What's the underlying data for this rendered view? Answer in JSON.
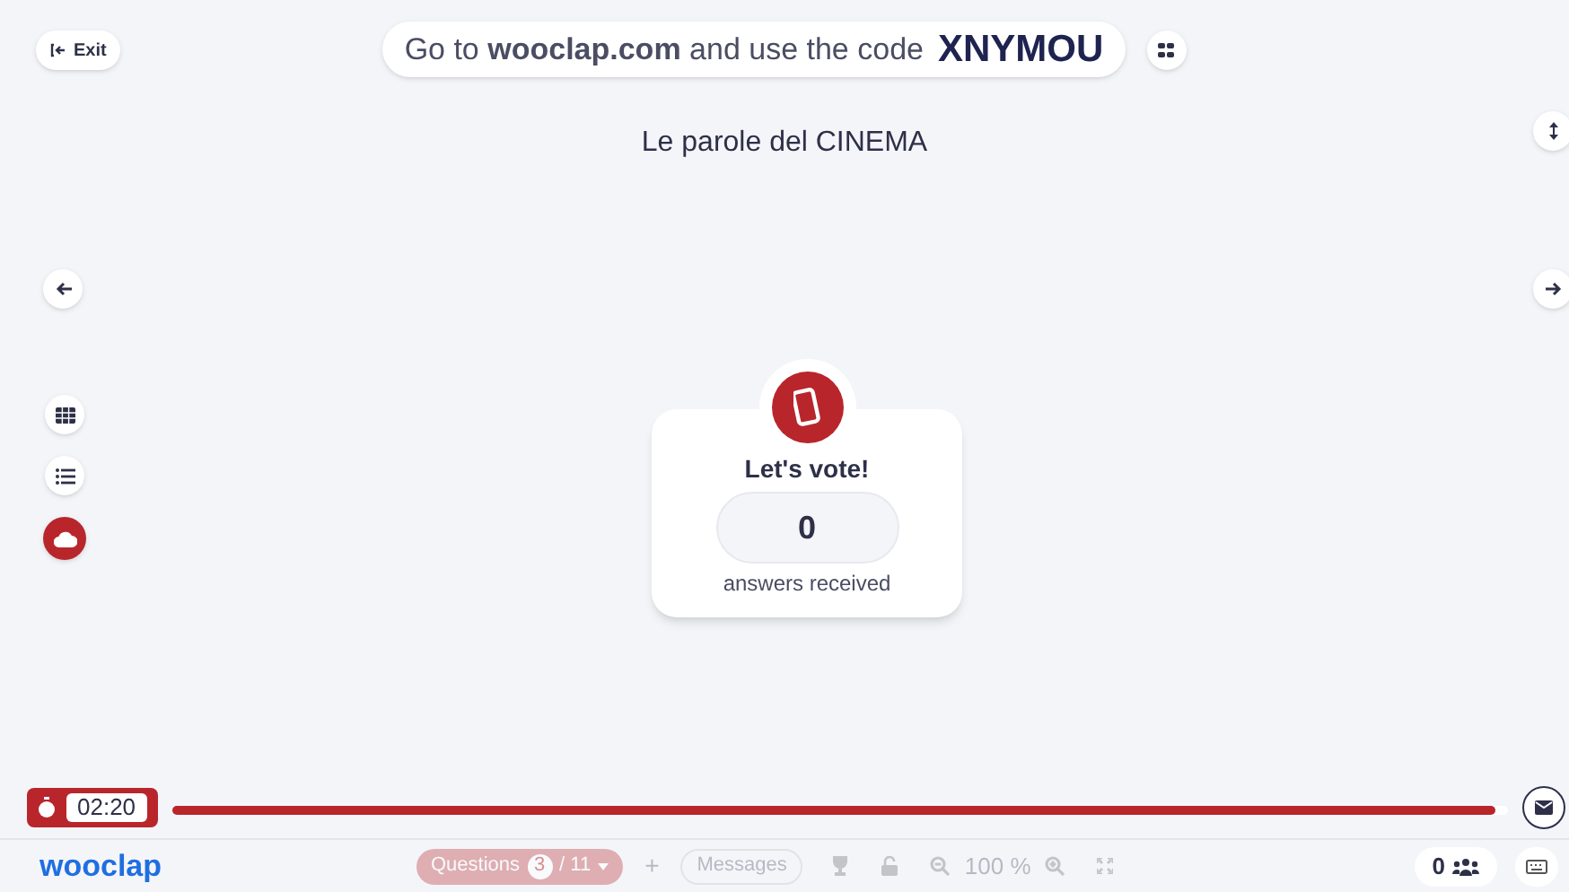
{
  "exit_button": {
    "label": "Exit"
  },
  "banner": {
    "text": "Go to **wooclap.com** and use the code",
    "code": "XNYMOU"
  },
  "title": "Le parole del CINEMA",
  "left_tools": [
    {
      "kind": "grid",
      "selected": false
    },
    {
      "kind": "list",
      "selected": false
    },
    {
      "kind": "cloud",
      "selected": true
    }
  ],
  "vote_card": {
    "heading": "Let's vote!",
    "count": "0",
    "caption": "answers received"
  },
  "timer": {
    "time": "02:20",
    "level": 0.99
  },
  "toolbar": {
    "logo": "wooclap",
    "questions": {
      "label": "Questions",
      "current": "3",
      "total": "/ 11",
      "disabled": true
    },
    "add": {
      "label": "+",
      "disabled": true
    },
    "messages": {
      "label": "Messages",
      "disabled": true
    },
    "zoom": {
      "label": "100 %",
      "disabled": true
    },
    "participants": "0"
  }
}
